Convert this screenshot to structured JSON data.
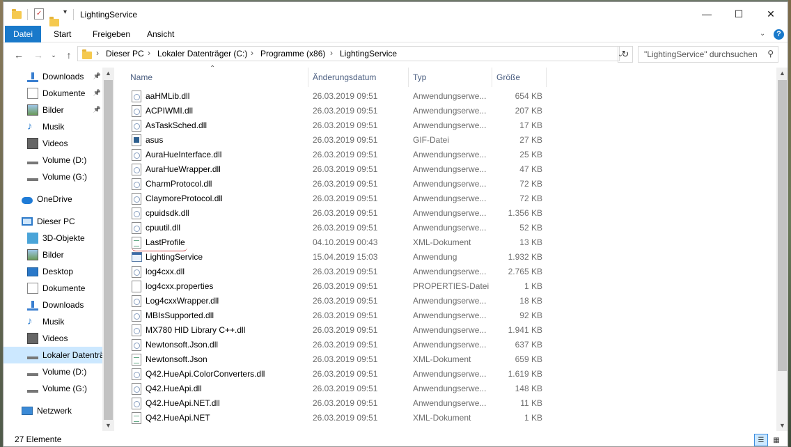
{
  "window": {
    "title": "LightingService",
    "minimize": "—",
    "maximize": "☐",
    "close": "✕"
  },
  "ribbon": {
    "tabs": [
      "Datei",
      "Start",
      "Freigeben",
      "Ansicht"
    ],
    "help": "?"
  },
  "address": {
    "crumbs": [
      "Dieser PC",
      "Lokaler Datenträger (C:)",
      "Programme (x86)",
      "LightingService"
    ],
    "search_placeholder": "\"LightingService\" durchsuchen"
  },
  "nav": {
    "items": [
      {
        "label": "Downloads",
        "icon": "download-icon",
        "pinned": true
      },
      {
        "label": "Dokumente",
        "icon": "document-icon",
        "pinned": true
      },
      {
        "label": "Bilder",
        "icon": "picture-icon",
        "pinned": true
      },
      {
        "label": "Musik",
        "icon": "music-icon",
        "pinned": false
      },
      {
        "label": "Videos",
        "icon": "video-icon",
        "pinned": false
      },
      {
        "label": "Volume (D:)",
        "icon": "drive-icon",
        "pinned": false
      },
      {
        "label": "Volume (G:)",
        "icon": "drive-icon",
        "pinned": false
      },
      {
        "label": "OneDrive",
        "icon": "cloud-icon",
        "pinned": false
      },
      {
        "label": "Dieser PC",
        "icon": "computer-icon",
        "pinned": false
      },
      {
        "label": "3D-Objekte",
        "icon": "cube-icon",
        "pinned": false
      },
      {
        "label": "Bilder",
        "icon": "picture-icon",
        "pinned": false
      },
      {
        "label": "Desktop",
        "icon": "desktop-icon",
        "pinned": false
      },
      {
        "label": "Dokumente",
        "icon": "document-icon",
        "pinned": false
      },
      {
        "label": "Downloads",
        "icon": "download-icon",
        "pinned": false
      },
      {
        "label": "Musik",
        "icon": "music-icon",
        "pinned": false
      },
      {
        "label": "Videos",
        "icon": "video-icon",
        "pinned": false
      },
      {
        "label": "Lokaler Datenträ",
        "icon": "drive-icon",
        "pinned": false,
        "selected": true
      },
      {
        "label": "Volume (D:)",
        "icon": "drive-icon",
        "pinned": false
      },
      {
        "label": "Volume (G:)",
        "icon": "drive-icon",
        "pinned": false
      },
      {
        "label": "Netzwerk",
        "icon": "network-icon",
        "pinned": false
      }
    ]
  },
  "list": {
    "columns": [
      "Name",
      "Änderungsdatum",
      "Typ",
      "Größe"
    ],
    "files": [
      {
        "name": "aaHMLib.dll",
        "date": "26.03.2019 09:51",
        "type": "Anwendungserwe...",
        "size": "654 KB",
        "icon": "dll"
      },
      {
        "name": "ACPIWMI.dll",
        "date": "26.03.2019 09:51",
        "type": "Anwendungserwe...",
        "size": "207 KB",
        "icon": "dll"
      },
      {
        "name": "AsTaskSched.dll",
        "date": "26.03.2019 09:51",
        "type": "Anwendungserwe...",
        "size": "17 KB",
        "icon": "dll"
      },
      {
        "name": "asus",
        "date": "26.03.2019 09:51",
        "type": "GIF-Datei",
        "size": "27 KB",
        "icon": "gif"
      },
      {
        "name": "AuraHueInterface.dll",
        "date": "26.03.2019 09:51",
        "type": "Anwendungserwe...",
        "size": "25 KB",
        "icon": "dll"
      },
      {
        "name": "AuraHueWrapper.dll",
        "date": "26.03.2019 09:51",
        "type": "Anwendungserwe...",
        "size": "47 KB",
        "icon": "dll"
      },
      {
        "name": "CharmProtocol.dll",
        "date": "26.03.2019 09:51",
        "type": "Anwendungserwe...",
        "size": "72 KB",
        "icon": "dll"
      },
      {
        "name": "ClaymoreProtocol.dll",
        "date": "26.03.2019 09:51",
        "type": "Anwendungserwe...",
        "size": "72 KB",
        "icon": "dll"
      },
      {
        "name": "cpuidsdk.dll",
        "date": "26.03.2019 09:51",
        "type": "Anwendungserwe...",
        "size": "1.356 KB",
        "icon": "dll"
      },
      {
        "name": "cpuutil.dll",
        "date": "26.03.2019 09:51",
        "type": "Anwendungserwe...",
        "size": "52 KB",
        "icon": "dll"
      },
      {
        "name": "LastProfile",
        "date": "04.10.2019 00:43",
        "type": "XML-Dokument",
        "size": "13 KB",
        "icon": "xml"
      },
      {
        "name": "LightingService",
        "date": "15.04.2019 15:03",
        "type": "Anwendung",
        "size": "1.932 KB",
        "icon": "exe"
      },
      {
        "name": "log4cxx.dll",
        "date": "26.03.2019 09:51",
        "type": "Anwendungserwe...",
        "size": "2.765 KB",
        "icon": "dll"
      },
      {
        "name": "log4cxx.properties",
        "date": "26.03.2019 09:51",
        "type": "PROPERTIES-Datei",
        "size": "1 KB",
        "icon": "txt"
      },
      {
        "name": "Log4cxxWrapper.dll",
        "date": "26.03.2019 09:51",
        "type": "Anwendungserwe...",
        "size": "18 KB",
        "icon": "dll"
      },
      {
        "name": "MBIsSupported.dll",
        "date": "26.03.2019 09:51",
        "type": "Anwendungserwe...",
        "size": "92 KB",
        "icon": "dll"
      },
      {
        "name": "MX780 HID Library C++.dll",
        "date": "26.03.2019 09:51",
        "type": "Anwendungserwe...",
        "size": "1.941 KB",
        "icon": "dll"
      },
      {
        "name": "Newtonsoft.Json.dll",
        "date": "26.03.2019 09:51",
        "type": "Anwendungserwe...",
        "size": "637 KB",
        "icon": "dll"
      },
      {
        "name": "Newtonsoft.Json",
        "date": "26.03.2019 09:51",
        "type": "XML-Dokument",
        "size": "659 KB",
        "icon": "xml"
      },
      {
        "name": "Q42.HueApi.ColorConverters.dll",
        "date": "26.03.2019 09:51",
        "type": "Anwendungserwe...",
        "size": "1.619 KB",
        "icon": "dll"
      },
      {
        "name": "Q42.HueApi.dll",
        "date": "26.03.2019 09:51",
        "type": "Anwendungserwe...",
        "size": "148 KB",
        "icon": "dll"
      },
      {
        "name": "Q42.HueApi.NET.dll",
        "date": "26.03.2019 09:51",
        "type": "Anwendungserwe...",
        "size": "11 KB",
        "icon": "dll"
      },
      {
        "name": "Q42.HueApi.NET",
        "date": "26.03.2019 09:51",
        "type": "XML-Dokument",
        "size": "1 KB",
        "icon": "xml"
      }
    ]
  },
  "status": {
    "count": "27 Elemente"
  },
  "colors": {
    "accent": "#1979ca",
    "selection": "#cce8ff",
    "header_text": "#4d6082",
    "annotation": "#d34a4a"
  }
}
